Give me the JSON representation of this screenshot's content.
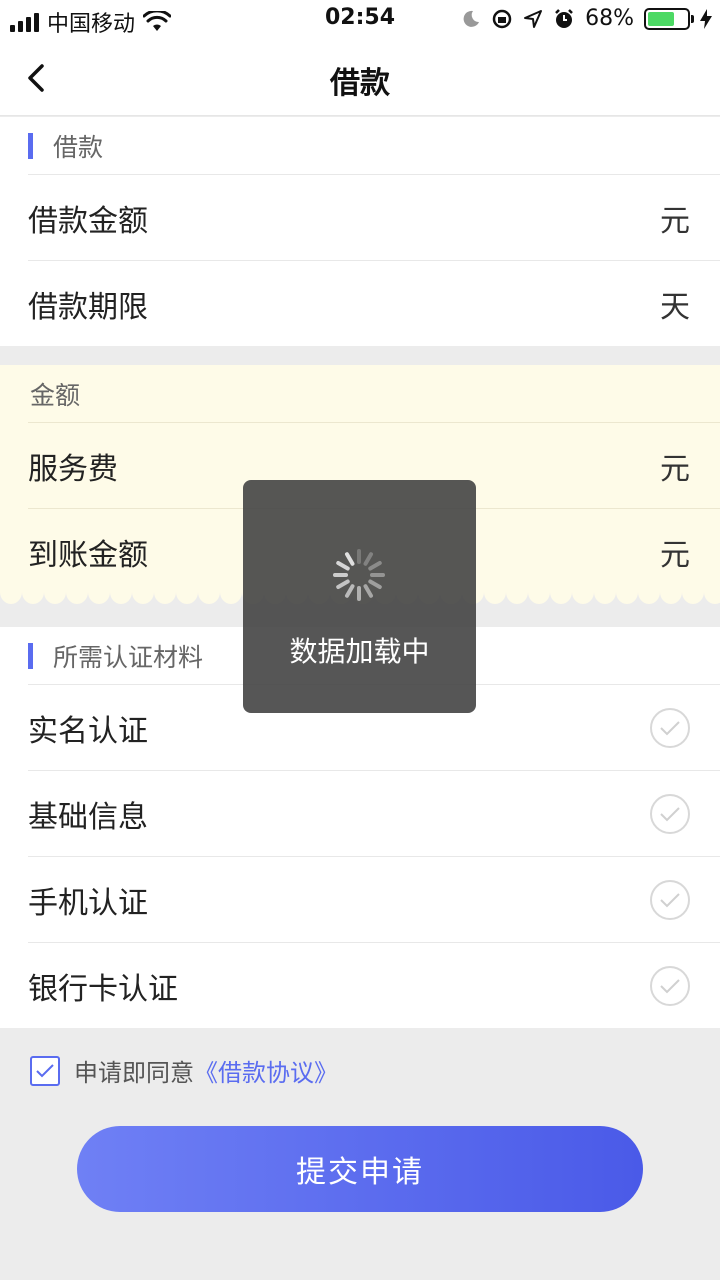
{
  "status_bar": {
    "carrier": "中国移动",
    "time": "02:54",
    "battery": "68%"
  },
  "nav": {
    "title": "借款"
  },
  "loan_section": {
    "header": "借款",
    "rows": [
      {
        "label": "借款金额",
        "unit": "元"
      },
      {
        "label": "借款期限",
        "unit": "天"
      }
    ]
  },
  "amount_section": {
    "header": "金额",
    "rows": [
      {
        "label": "服务费",
        "unit": "元"
      },
      {
        "label": "到账金额",
        "unit": "元"
      }
    ]
  },
  "materials_section": {
    "header": "所需认证材料",
    "items": [
      {
        "label": "实名认证"
      },
      {
        "label": "基础信息"
      },
      {
        "label": "手机认证"
      },
      {
        "label": "银行卡认证"
      }
    ]
  },
  "agreement": {
    "prefix": "申请即同意",
    "link": "《借款协议》",
    "checked": true
  },
  "submit_label": "提交申请",
  "loading_toast": {
    "text": "数据加载中"
  },
  "colors": {
    "accent": "#5a6cf0",
    "highlight_bg": "#fefbe8"
  }
}
